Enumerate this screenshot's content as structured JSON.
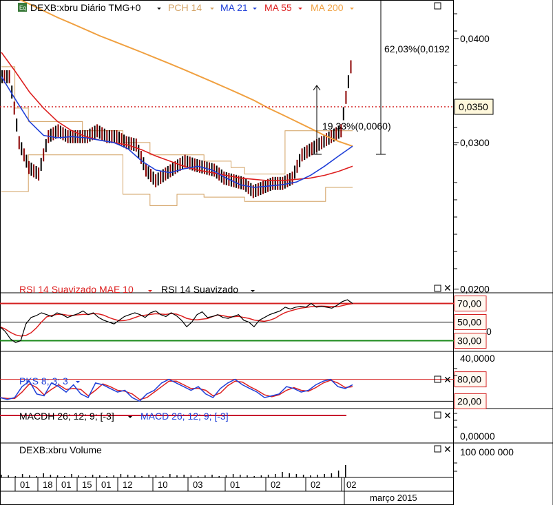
{
  "chart_data": [
    {
      "panel": "price",
      "type": "candlestick",
      "symbol_label": "DEXB:xbru Diário TMG+0",
      "icon": "eq-badge-icon",
      "legend": [
        {
          "name": "PCH 14",
          "color": "#d2a060"
        },
        {
          "name": "MA 21",
          "color": "#1f3fd8"
        },
        {
          "name": "MA 55",
          "color": "#dd1f1f"
        },
        {
          "name": "MA 200",
          "color": "#f0a040"
        }
      ],
      "scale": "log",
      "ylim": [
        0.0198,
        0.0445
      ],
      "y_ticks": [
        "0,0400",
        "0,0300",
        "0,0200"
      ],
      "y_tick_values": [
        0.04,
        0.03,
        0.02
      ],
      "last_price": 0.035,
      "last_price_label": "0,0350",
      "annotations": [
        {
          "text": "62,03%(0,0192",
          "from": 0.031,
          "to": 0.0502
        },
        {
          "text": "19,33%(0,0060)",
          "from": 0.031,
          "to": 0.037
        }
      ],
      "series_ma200": [
        0.0455,
        0.0448,
        0.044,
        0.0432,
        0.0424,
        0.0417,
        0.041,
        0.0403,
        0.0397,
        0.0391,
        0.0385,
        0.0379,
        0.0373,
        0.0367,
        0.0361,
        0.0355,
        0.0349,
        0.0343,
        0.0337,
        0.033,
        0.0324,
        0.0318,
        0.0312,
        0.0306,
        0.0301,
        0.0297
      ],
      "series_ma55": [
        0.0385,
        0.0365,
        0.0345,
        0.033,
        0.0318,
        0.031,
        0.0305,
        0.0302,
        0.03,
        0.0298,
        0.0294,
        0.0289,
        0.0285,
        0.0281,
        0.0278,
        0.0276,
        0.0274,
        0.0272,
        0.0271,
        0.027,
        0.027,
        0.0271,
        0.0272,
        0.0274,
        0.0277,
        0.0281
      ],
      "series_ma21": [
        0.036,
        0.0338,
        0.0318,
        0.0306,
        0.0304,
        0.0305,
        0.0304,
        0.0302,
        0.03,
        0.0295,
        0.0285,
        0.0278,
        0.0276,
        0.0279,
        0.0281,
        0.0278,
        0.0272,
        0.0267,
        0.0265,
        0.0266,
        0.0267,
        0.0269,
        0.0274,
        0.0281,
        0.0289,
        0.0297
      ],
      "pch_upper": [
        0.037,
        0.033,
        0.0318,
        0.0318,
        0.0318,
        0.0318,
        0.031,
        0.031,
        0.031,
        0.03,
        0.03,
        0.029,
        0.029,
        0.029,
        0.029,
        0.0285,
        0.0285,
        0.028,
        0.0275,
        0.0275,
        0.0275,
        0.031,
        0.031,
        0.031,
        0.031,
        0.031
      ],
      "pch_lower": [
        0.0262,
        0.0262,
        0.029,
        0.029,
        0.029,
        0.029,
        0.029,
        0.029,
        0.029,
        0.026,
        0.026,
        0.0252,
        0.0252,
        0.026,
        0.026,
        0.0258,
        0.0258,
        0.0258,
        0.0255,
        0.0255,
        0.0255,
        0.0255,
        0.0255,
        0.0255,
        0.0265,
        0.0265
      ],
      "candles": [
        0.036,
        0.03,
        0.028,
        0.0275,
        0.0305,
        0.031,
        0.0305,
        0.0305,
        0.0305,
        0.031,
        0.0305,
        0.0305,
        0.03,
        0.0298,
        0.0278,
        0.027,
        0.0275,
        0.028,
        0.0285,
        0.0282,
        0.028,
        0.0278,
        0.0272,
        0.027,
        0.0268,
        0.0262,
        0.0265,
        0.0268,
        0.0268,
        0.0272,
        0.029,
        0.0295,
        0.03,
        0.0305,
        0.031,
        0.037
      ]
    },
    {
      "panel": "rsi",
      "type": "line",
      "label_1": "RSI 14 Suavizado MAE 10",
      "label_2": "RSI 14 Suavizado",
      "levels": [
        "70,00",
        "50,00",
        "30,00"
      ],
      "level_values": [
        70,
        50,
        30
      ],
      "ylim": [
        20,
        80
      ],
      "y_tick_hidden": "40,0000",
      "y_tick_clipped": "0",
      "values": [
        45,
        40,
        32,
        28,
        30,
        48,
        55,
        57,
        60,
        58,
        56,
        60,
        58,
        55,
        57,
        59,
        62,
        58,
        60,
        55,
        52,
        50,
        48,
        52,
        56,
        58,
        60,
        58,
        55,
        60,
        62,
        58,
        56,
        60,
        57,
        52,
        45,
        50,
        58,
        61,
        55,
        56,
        58,
        55,
        54,
        56,
        58,
        52,
        50,
        45,
        52,
        55,
        58,
        60,
        62,
        66,
        64,
        66,
        67,
        66,
        70,
        66,
        67,
        66,
        65,
        68,
        72,
        74,
        70
      ]
    },
    {
      "panel": "stochastic",
      "type": "line",
      "label": "PKS 8; 3; 3",
      "levels": [
        "80,00",
        "20,00"
      ],
      "level_values": [
        80,
        20
      ],
      "ylim": [
        0,
        100
      ],
      "values": [
        30,
        25,
        30,
        60,
        75,
        40,
        35,
        70,
        60,
        45,
        65,
        40,
        30,
        70,
        65,
        55,
        45,
        50,
        30,
        20,
        40,
        50,
        70,
        80,
        70,
        60,
        50,
        60,
        40,
        30,
        55,
        70,
        80,
        65,
        55,
        45,
        30,
        35,
        40,
        60,
        55,
        45,
        50,
        65,
        75,
        80,
        60,
        55,
        65
      ]
    },
    {
      "panel": "macd",
      "type": "line",
      "label_1": "MACDH 26; 12; 9; [-3]",
      "label_2": "MACD 26; 12; 9; [-3]",
      "y_ticks": [
        "0,00000"
      ],
      "values": [
        0,
        0,
        0,
        0,
        0,
        0,
        0,
        0,
        0,
        0
      ]
    },
    {
      "panel": "volume",
      "type": "bar",
      "label": "DEXB:xbru Volume",
      "y_ticks": [
        "100 000 000"
      ],
      "values": [
        4,
        3,
        2,
        5,
        3,
        2,
        6,
        4,
        3,
        2,
        5,
        3,
        2,
        4,
        3,
        2,
        3,
        5,
        4,
        3,
        2,
        4,
        3,
        2,
        5,
        3,
        4,
        3,
        2,
        3,
        4,
        2,
        3,
        5,
        4,
        3,
        2,
        3,
        4,
        5,
        8,
        6,
        5,
        4,
        3,
        4,
        5,
        6,
        10,
        18
      ]
    }
  ],
  "x_axis": {
    "ticks": [
      "01",
      "18",
      "01",
      "15",
      "01",
      "12",
      "10",
      "03",
      "01",
      "02",
      "02",
      "02"
    ],
    "month_label": "março 2015"
  },
  "colors": {
    "candle_up": "#000000",
    "candle_down": "#8b0000",
    "rsi_line": "#000000",
    "rsi_signal": "#dd1f1f",
    "level_red": "#d42020",
    "level_green": "#1a8a1a",
    "stoch_k": "#1f3fd8",
    "stoch_d": "#dd1f1f",
    "dotted_price": "#d42020"
  }
}
